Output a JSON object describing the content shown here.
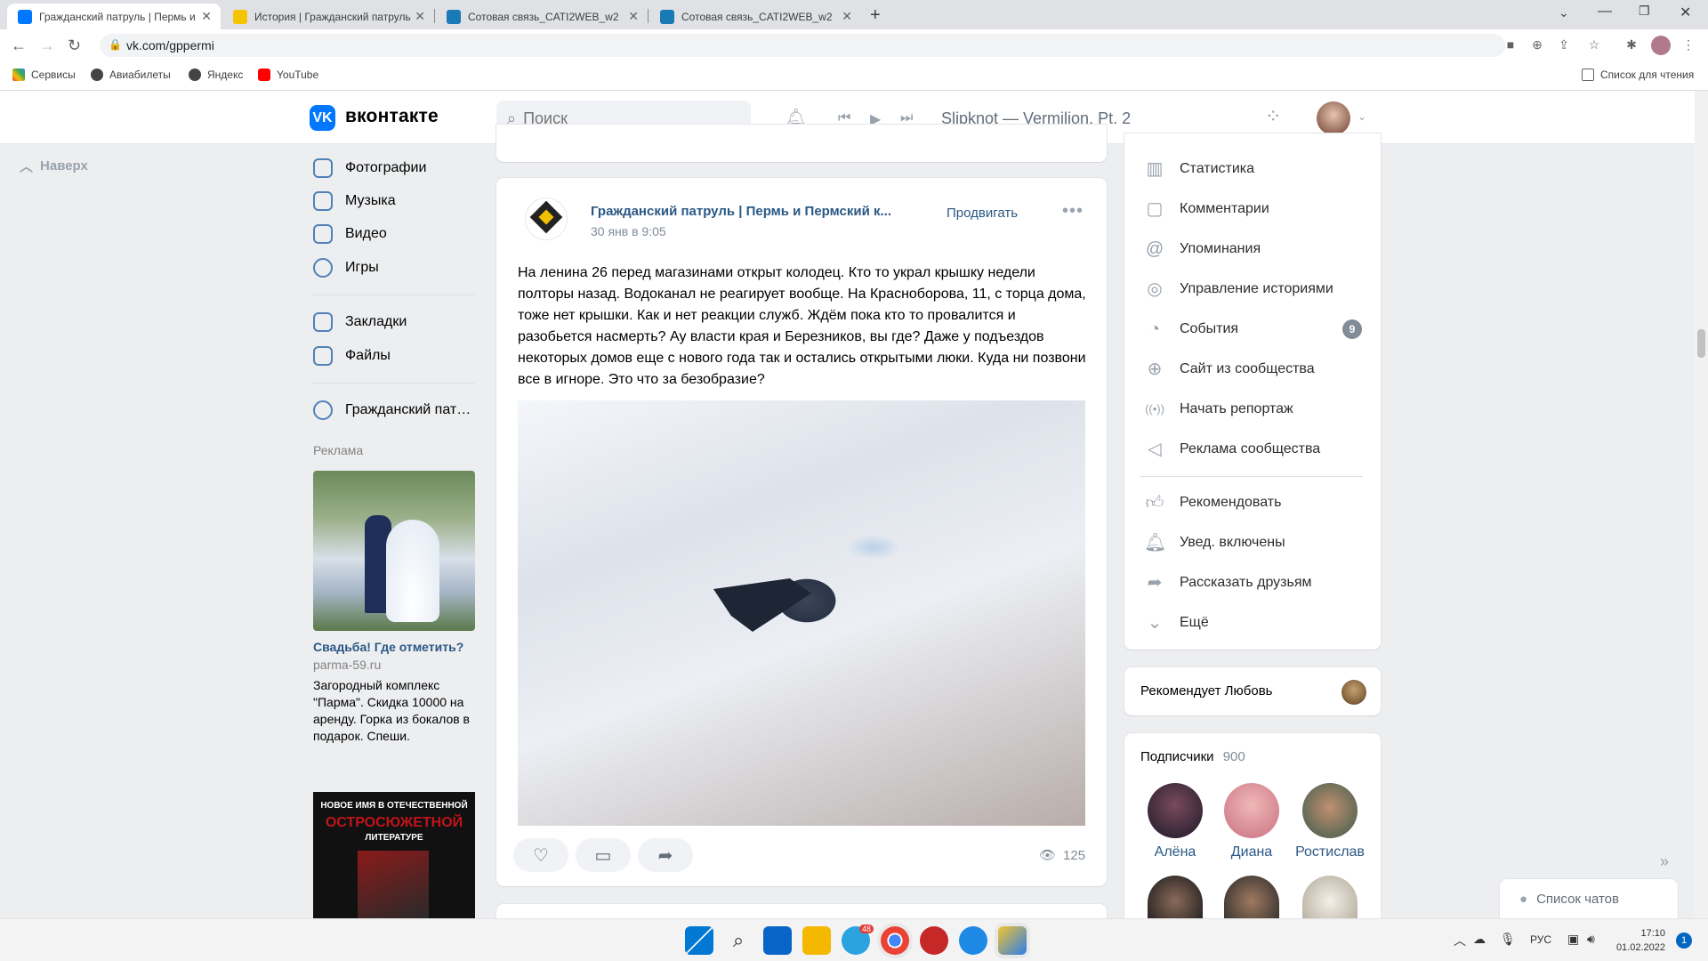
{
  "browser": {
    "tabs": [
      {
        "title": "Гражданский патруль | Пермь и",
        "color": "#0077ff"
      },
      {
        "title": "История | Гражданский патруль",
        "color": "#333333"
      },
      {
        "title": "Сотовая связь_CATI2WEB_w2",
        "color": "#1a7ab5"
      },
      {
        "title": "Сотовая связь_CATI2WEB_w2",
        "color": "#1a7ab5"
      }
    ],
    "url": "vk.com/gppermi",
    "bookmarks": [
      "Сервисы",
      "Авиабилеты",
      "Яндекс",
      "YouTube"
    ],
    "reading_list": "Список для чтения"
  },
  "vk": {
    "brand": "вконтакте",
    "search_placeholder": "Поиск",
    "now_playing": "Slipknot — Vermilion, Pt. 2",
    "scroll_top": "Наверх",
    "menu": [
      {
        "label": "Фотографии",
        "icon": "photo-icon"
      },
      {
        "label": "Музыка",
        "icon": "music-icon"
      },
      {
        "label": "Видео",
        "icon": "video-icon"
      },
      {
        "label": "Игры",
        "icon": "games-icon"
      },
      {
        "label": "Закладки",
        "icon": "bookmark-icon"
      },
      {
        "label": "Файлы",
        "icon": "file-icon"
      },
      {
        "label": "Гражданский пат…",
        "icon": "group-icon"
      }
    ],
    "ad": {
      "heading": "Реклама",
      "title": "Свадьба! Где отметить?",
      "domain": "parma-59.ru",
      "text": "Загородный комплекс \"Парма\". Скидка 10000 на аренду. Горка из бокалов в подарок. Спеши.",
      "book_line1": "НОВОЕ ИМЯ В ОТЕЧЕСТВЕННОЙ",
      "book_line2": "ОСТРОСЮЖЕТНОЙ",
      "book_line3": "ЛИТЕРАТУРЕ"
    },
    "post": {
      "author": "Гражданский патруль | Пермь и Пермский к...",
      "date": "30 янв в 9:05",
      "promote": "Продвигать",
      "text": "На ленина 26 перед магазинами открыт колодец. Кто то украл крышку недели полторы назад. Водоканал не реагирует вообще. На Красноборова, 11, с торца дома, тоже нет крышки. Как и нет реакции служб. Ждём пока кто то провалится и разобьется насмерть? Ау власти края и Березников, вы где? Даже у подъездов некоторых домов еще с нового года так и остались открытыми люки. Куда ни позвони все в игноре. Это что за безобразие?",
      "views": "125"
    },
    "right_menu": [
      {
        "label": "Статистика",
        "icon": "stats-icon",
        "glyph": "▥"
      },
      {
        "label": "Комментарии",
        "icon": "comment-icon",
        "glyph": "▢"
      },
      {
        "label": "Упоминания",
        "icon": "at-icon",
        "glyph": "@"
      },
      {
        "label": "Управление историями",
        "icon": "stories-icon",
        "glyph": "◎"
      },
      {
        "label": "События",
        "icon": "events-icon",
        "glyph": "◔",
        "badge": "9"
      },
      {
        "label": "Сайт из сообщества",
        "icon": "globe-icon",
        "glyph": "⊕"
      },
      {
        "label": "Начать репортаж",
        "icon": "live-icon",
        "glyph": "((•))"
      },
      {
        "label": "Реклама сообщества",
        "icon": "megaphone-icon",
        "glyph": "◁"
      },
      {
        "label": "Рекомендовать",
        "icon": "like-icon",
        "glyph": "👍"
      },
      {
        "label": "Увед. включены",
        "icon": "bell-icon",
        "glyph": "🔔"
      },
      {
        "label": "Рассказать друзьям",
        "icon": "share-icon",
        "glyph": "➦"
      },
      {
        "label": "Ещё",
        "icon": "chevron-down-icon",
        "glyph": "⌄"
      }
    ],
    "recommends": "Рекомендует Любовь",
    "subscribers": {
      "label": "Подписчики",
      "count": "900",
      "names": [
        "Алёна",
        "Диана",
        "Ростислав"
      ]
    },
    "chats": "Список чатов"
  },
  "taskbar": {
    "lang": "РУС",
    "time": "17:10",
    "date": "01.02.2022",
    "notif": "1",
    "telegram_badge": "48"
  }
}
